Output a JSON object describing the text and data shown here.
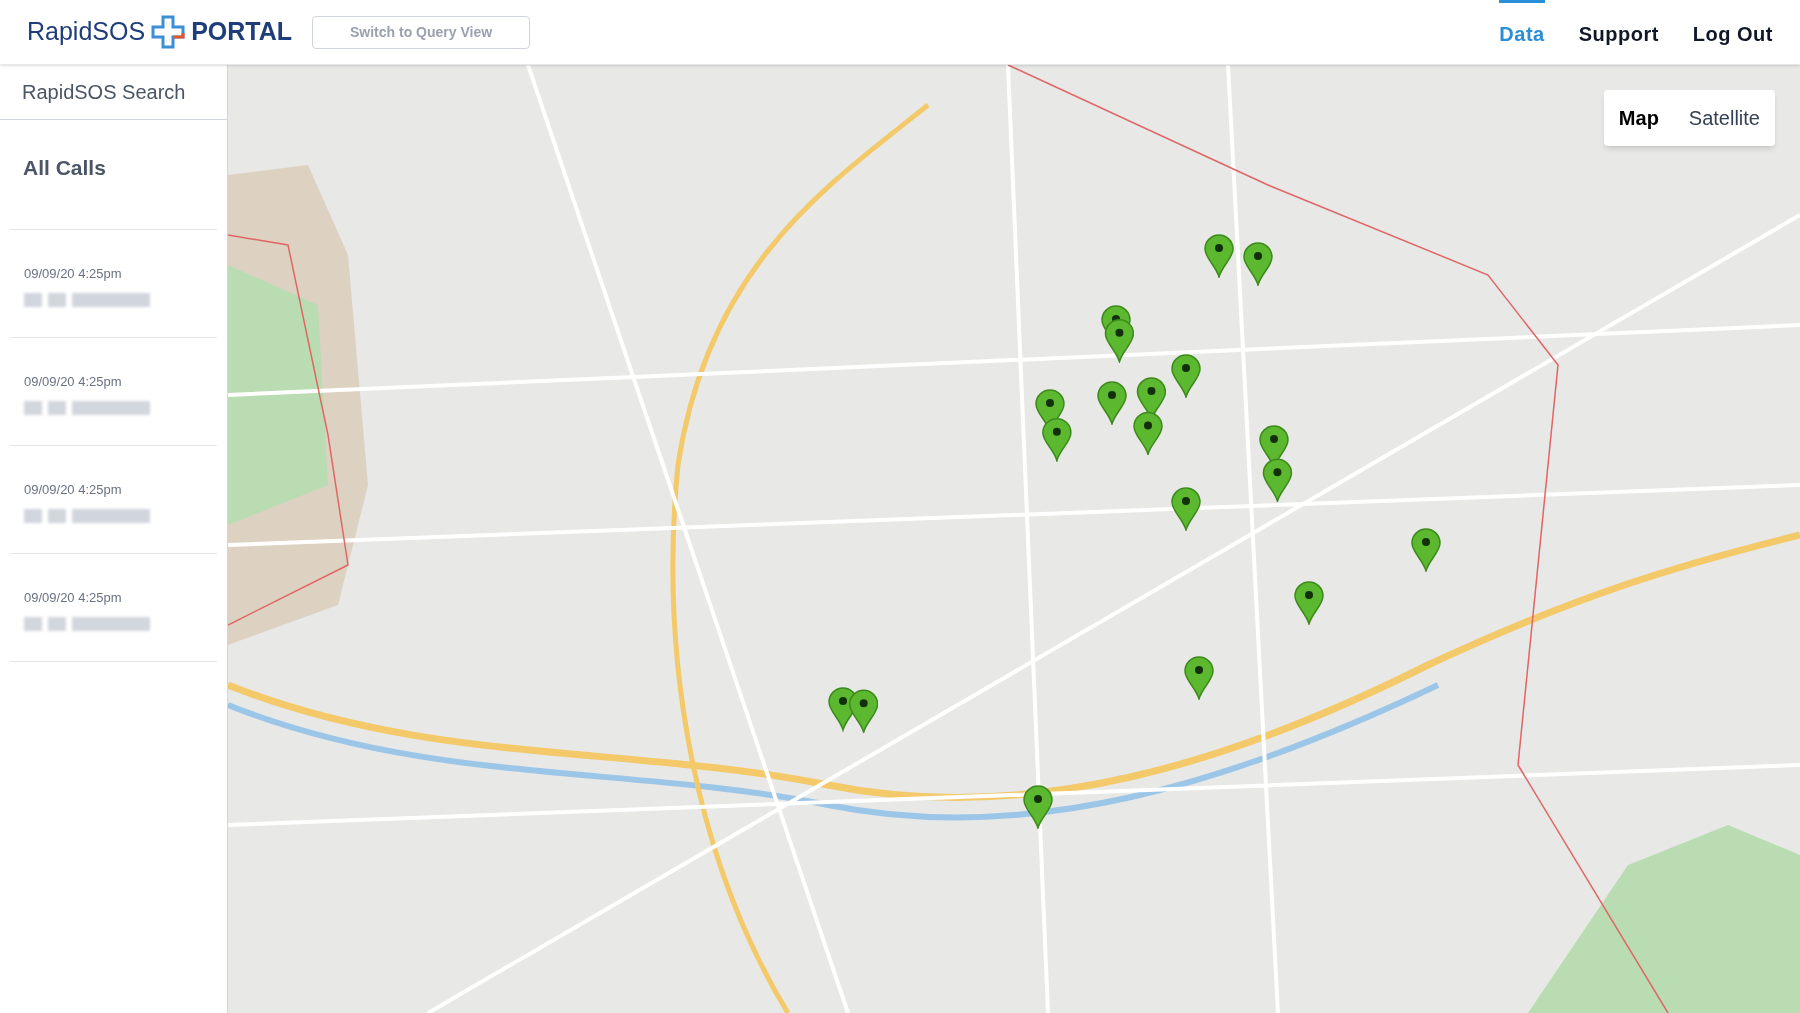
{
  "header": {
    "logo": {
      "brand": "RapidSOS",
      "product": "PORTAL"
    },
    "query_button": "Switch to Query View",
    "nav": [
      {
        "label": "Data",
        "selected": true
      },
      {
        "label": "Support",
        "selected": false
      },
      {
        "label": "Log Out",
        "selected": false
      }
    ]
  },
  "sidebar": {
    "search_title": "RapidSOS Search",
    "heading": "All Calls",
    "calls": [
      {
        "time": "09/09/20 4:25pm"
      },
      {
        "time": "09/09/20 4:25pm"
      },
      {
        "time": "09/09/20 4:25pm"
      },
      {
        "time": "09/09/20 4:25pm"
      }
    ]
  },
  "map": {
    "view_toggle": [
      {
        "label": "Map",
        "selected": true
      },
      {
        "label": "Satellite",
        "selected": false
      }
    ]
  }
}
